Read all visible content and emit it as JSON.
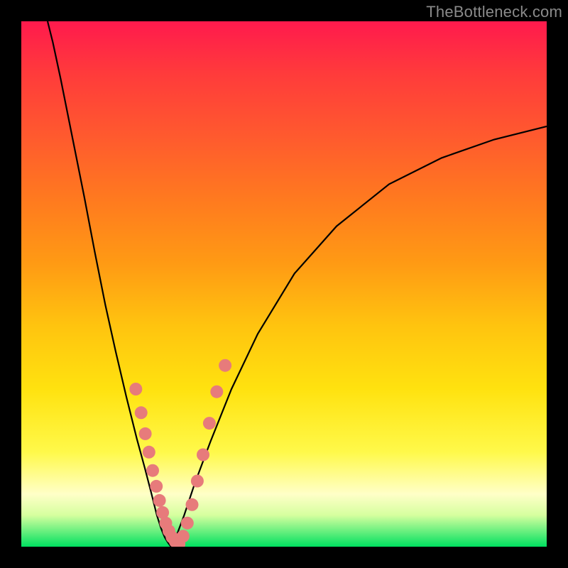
{
  "watermark": "TheBottleneck.com",
  "colors": {
    "frame": "#000000",
    "curve": "#000000",
    "dot": "#e77b7b",
    "gradient_stops": [
      "#ff1a4d",
      "#ff3b3b",
      "#ff5a2e",
      "#ff7a1f",
      "#ff9a14",
      "#ffc40f",
      "#ffe20f",
      "#fff94a",
      "#ffffc8",
      "#d6ff9f",
      "#00e060"
    ]
  },
  "chart_data": {
    "type": "line",
    "title": "",
    "xlabel": "",
    "ylabel": "",
    "xlim": [
      0,
      1
    ],
    "ylim": [
      0,
      1
    ],
    "series": [
      {
        "name": "left-branch",
        "x": [
          0.05,
          0.06,
          0.075,
          0.09,
          0.105,
          0.12,
          0.14,
          0.16,
          0.18,
          0.2,
          0.22,
          0.235,
          0.248,
          0.258,
          0.266,
          0.273,
          0.279,
          0.285
        ],
        "y": [
          1.0,
          0.96,
          0.89,
          0.815,
          0.74,
          0.665,
          0.56,
          0.46,
          0.37,
          0.285,
          0.205,
          0.15,
          0.1,
          0.06,
          0.035,
          0.018,
          0.008,
          0.0
        ]
      },
      {
        "name": "right-branch",
        "x": [
          0.285,
          0.295,
          0.31,
          0.33,
          0.36,
          0.4,
          0.45,
          0.52,
          0.6,
          0.7,
          0.8,
          0.9,
          1.0
        ],
        "y": [
          0.0,
          0.02,
          0.06,
          0.12,
          0.2,
          0.3,
          0.405,
          0.52,
          0.61,
          0.69,
          0.74,
          0.775,
          0.8
        ]
      },
      {
        "name": "dots-left",
        "x": [
          0.218,
          0.228,
          0.236,
          0.243,
          0.25,
          0.257,
          0.263,
          0.269,
          0.275,
          0.281,
          0.287,
          0.293,
          0.3
        ],
        "y": [
          0.3,
          0.255,
          0.215,
          0.18,
          0.145,
          0.115,
          0.088,
          0.065,
          0.045,
          0.03,
          0.018,
          0.01,
          0.005
        ]
      },
      {
        "name": "dots-right",
        "x": [
          0.3,
          0.308,
          0.316,
          0.325,
          0.335,
          0.346,
          0.358,
          0.372,
          0.388
        ],
        "y": [
          0.005,
          0.02,
          0.045,
          0.08,
          0.125,
          0.175,
          0.235,
          0.295,
          0.345
        ]
      }
    ]
  }
}
